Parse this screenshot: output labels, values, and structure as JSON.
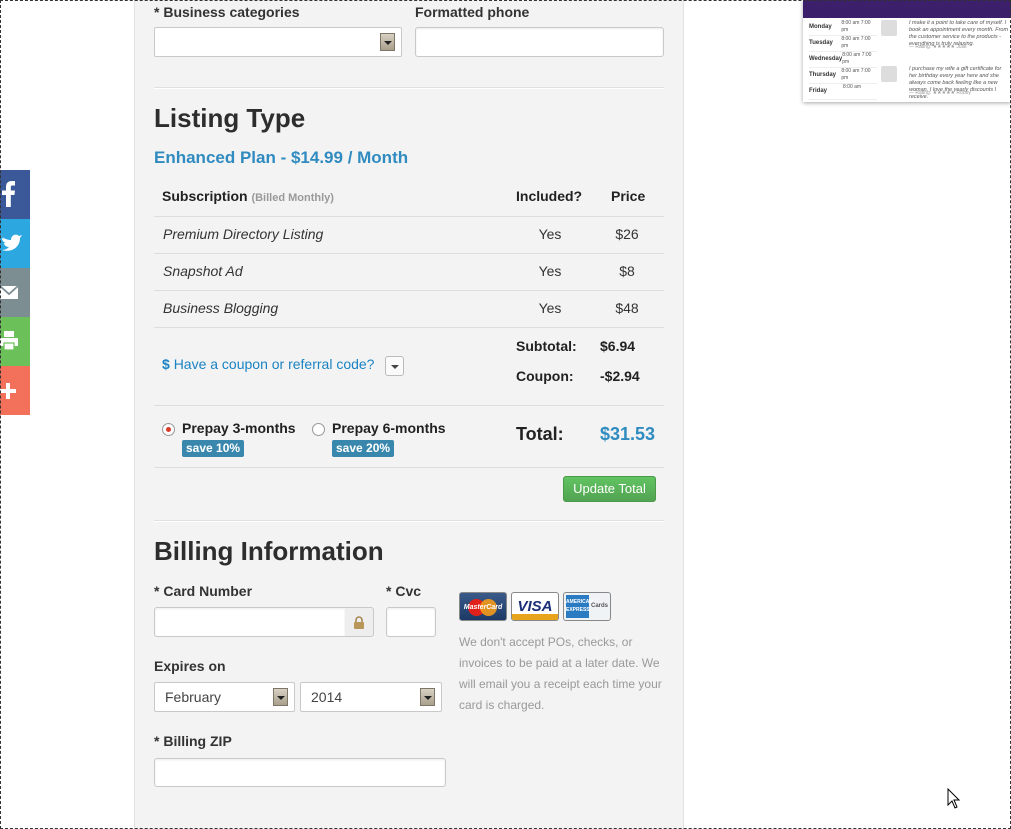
{
  "form_top": {
    "business_categories_label": "* Business categories",
    "business_categories_value": "",
    "formatted_phone_label": "Formatted phone",
    "formatted_phone_value": ""
  },
  "listing": {
    "heading": "Listing Type",
    "plan": "Enhanced Plan - $14.99 / Month",
    "table": {
      "col_subscription": "Subscription",
      "col_subscription_note": "(Billed Monthly)",
      "col_included": "Included?",
      "col_price": "Price",
      "rows": [
        {
          "name": "Premium Directory Listing",
          "included": "Yes",
          "price": "$26"
        },
        {
          "name": "Snapshot Ad",
          "included": "Yes",
          "price": "$8"
        },
        {
          "name": "Business Blogging",
          "included": "Yes",
          "price": "$48"
        }
      ]
    },
    "coupon_icon": "$",
    "coupon_link": "Have a coupon or referral code?",
    "subtotal_label": "Subtotal:",
    "subtotal_value": "$6.94",
    "coupon_label": "Coupon:",
    "coupon_value": "-$2.94",
    "prepay_options": [
      {
        "label": "Prepay 3-months",
        "badge": "save 10%",
        "selected": true
      },
      {
        "label": "Prepay 6-months",
        "badge": "save 20%",
        "selected": false
      }
    ],
    "total_label": "Total:",
    "total_value": "$31.53",
    "update_button": "Update Total"
  },
  "billing": {
    "heading": "Billing Information",
    "card_number_label": "* Card Number",
    "card_number_value": "",
    "cvc_label": "* Cvc",
    "cvc_value": "",
    "expires_label": "Expires on",
    "month_value": "February",
    "year_value": "2014",
    "zip_label": "* Billing ZIP",
    "zip_value": "",
    "cards": {
      "mastercard": "MasterCard",
      "visa": "VISA",
      "amex_word": "AMERICAN EXPRESS",
      "amex_sub": "Cards"
    },
    "note": "We don't accept POs, checks, or invoices to be paid at a later date. We will email you a receipt each time your card is charged."
  },
  "social_share": [
    {
      "name": "facebook",
      "color": "#3b5998"
    },
    {
      "name": "twitter",
      "color": "#2ca7e0"
    },
    {
      "name": "email",
      "color": "#7d8e93"
    },
    {
      "name": "print",
      "color": "#6cc05a"
    },
    {
      "name": "more",
      "color": "#f3715a"
    }
  ],
  "thumbnail": {
    "days": [
      {
        "day": "Monday",
        "times": "8:00 am 7:00 pm"
      },
      {
        "day": "Tuesday",
        "times": "8:00 am 7:00 pm"
      },
      {
        "day": "Wednesday",
        "times": "8:00 am 7:00 pm"
      },
      {
        "day": "Thursday",
        "times": "8:00 am 7:00 pm"
      },
      {
        "day": "Friday",
        "times": "8:00 am"
      }
    ],
    "review1": "I make it a point to take care of myself. I book an appointment every month. From the customer service to the products - everything is truly relaxing.",
    "review1_author": "— Rating: ★★★★★ Julie",
    "review2": "I purchase my wife a gift certificate for her birthday every year here and she always come back feeling like a new woman. I love the yearly discounts I receive.",
    "review2_author": "— Rating: ★★★★★ Robby"
  }
}
